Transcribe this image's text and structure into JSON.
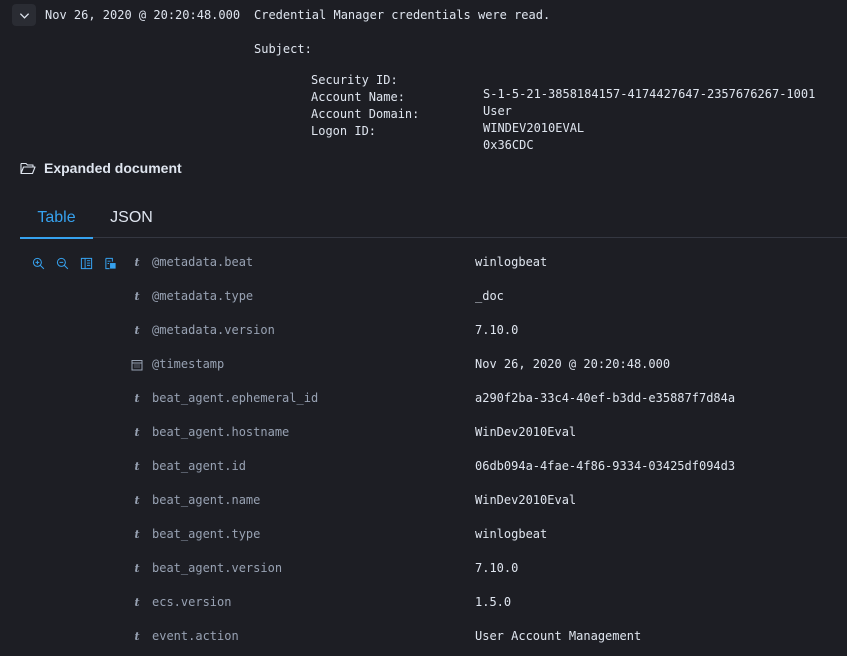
{
  "event": {
    "timestamp": "Nov 26, 2020 @ 20:20:48.000",
    "message": "Credential Manager credentials were read.",
    "subject_label": "Subject:",
    "subject_fields": [
      {
        "key": "Security ID:",
        "value": "S-1-5-21-3858184157-4174427647-2357676267-1001"
      },
      {
        "key": "Account Name:",
        "value": "User"
      },
      {
        "key": "Account Domain:",
        "value": "WINDEV2010EVAL"
      },
      {
        "key": "Logon ID:",
        "value": "0x36CDC"
      }
    ]
  },
  "expanded": {
    "title": "Expanded document",
    "icon": "folder-open-icon"
  },
  "tabs": [
    {
      "label": "Table",
      "active": true
    },
    {
      "label": "JSON",
      "active": false
    }
  ],
  "row_actions": [
    "zoom-in-icon",
    "zoom-out-icon",
    "toggle-column-icon",
    "filter-exists-icon"
  ],
  "colors": {
    "background": "#1d1e24",
    "text": "#dfe5ef",
    "muted": "#98a2b3",
    "accent": "#36a2ef",
    "border": "#343741"
  },
  "fields": [
    {
      "type": "string",
      "type_glyph": "t",
      "name": "@metadata.beat",
      "value": "winlogbeat"
    },
    {
      "type": "string",
      "type_glyph": "t",
      "name": "@metadata.type",
      "value": "_doc"
    },
    {
      "type": "string",
      "type_glyph": "t",
      "name": "@metadata.version",
      "value": "7.10.0"
    },
    {
      "type": "date",
      "type_glyph": "calendar-icon",
      "name": "@timestamp",
      "value": "Nov 26, 2020 @ 20:20:48.000"
    },
    {
      "type": "string",
      "type_glyph": "t",
      "name": "beat_agent.ephemeral_id",
      "value": "a290f2ba-33c4-40ef-b3dd-e35887f7d84a"
    },
    {
      "type": "string",
      "type_glyph": "t",
      "name": "beat_agent.hostname",
      "value": "WinDev2010Eval"
    },
    {
      "type": "string",
      "type_glyph": "t",
      "name": "beat_agent.id",
      "value": "06db094a-4fae-4f86-9334-03425df094d3"
    },
    {
      "type": "string",
      "type_glyph": "t",
      "name": "beat_agent.name",
      "value": "WinDev2010Eval"
    },
    {
      "type": "string",
      "type_glyph": "t",
      "name": "beat_agent.type",
      "value": "winlogbeat"
    },
    {
      "type": "string",
      "type_glyph": "t",
      "name": "beat_agent.version",
      "value": "7.10.0"
    },
    {
      "type": "string",
      "type_glyph": "t",
      "name": "ecs.version",
      "value": "1.5.0"
    },
    {
      "type": "string",
      "type_glyph": "t",
      "name": "event.action",
      "value": "User Account Management"
    }
  ]
}
